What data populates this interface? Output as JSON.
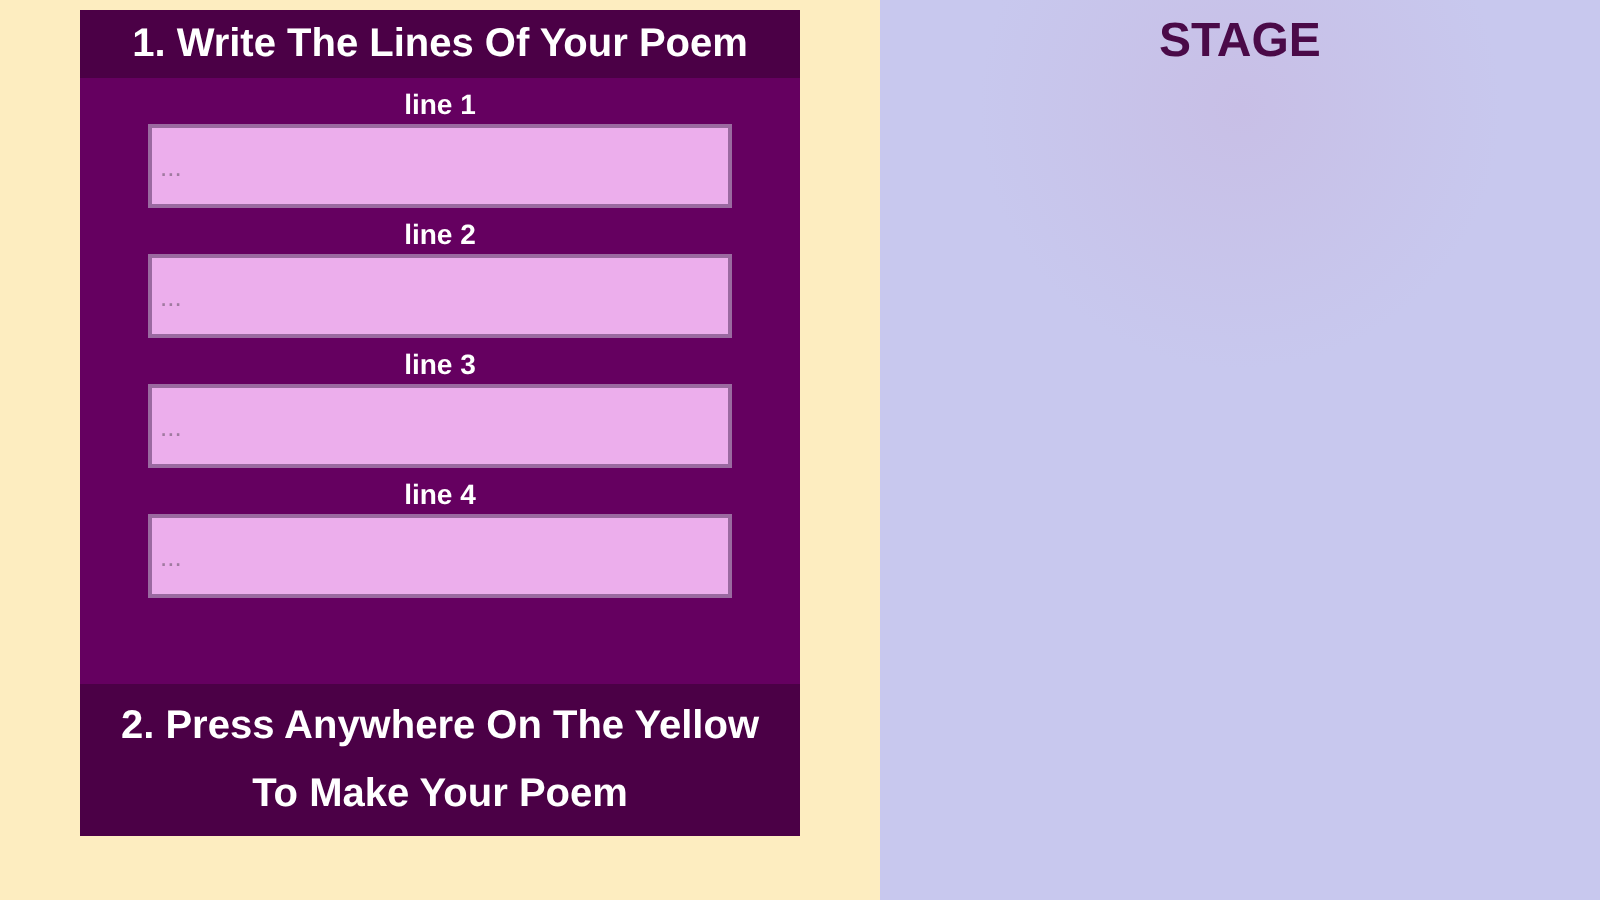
{
  "panel": {
    "title": "1. Write The Lines Of Your Poem",
    "lines": [
      {
        "label": "line 1",
        "placeholder": "..."
      },
      {
        "label": "line 2",
        "placeholder": "..."
      },
      {
        "label": "line 3",
        "placeholder": "..."
      },
      {
        "label": "line 4",
        "placeholder": "..."
      }
    ],
    "instruction": "2. Press Anywhere On The Yellow To Make Your Poem"
  },
  "stage": {
    "title": "STAGE"
  }
}
